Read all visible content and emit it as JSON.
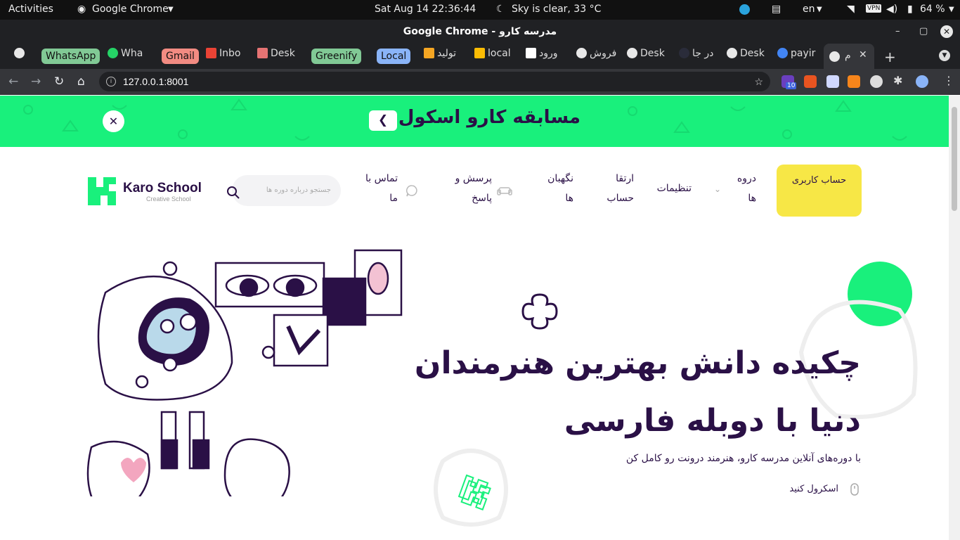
{
  "os_bar": {
    "activities": "Activities",
    "app_name": "Google Chrome",
    "datetime": "Sat Aug 14  22:36:44",
    "weather": "Sky is clear, 33 °C",
    "lang": "en",
    "vpn": "VPN",
    "battery": "64 %"
  },
  "window": {
    "title": "مدرسه کارو - Google Chrome"
  },
  "tabs": {
    "groups": [
      "WhatsApp",
      "Gmail",
      "Greenify",
      "Local"
    ],
    "items": [
      "Wha",
      "Inbo",
      "Desk",
      "تولید",
      "local",
      "ورود",
      "فروش",
      "Desk",
      "در جا",
      "Desk",
      "payir",
      "م"
    ]
  },
  "toolbar": {
    "url": "127.0.0.1:8001",
    "ext_badge": "10"
  },
  "banner": {
    "title": "مسابقه کارو اسکول"
  },
  "header": {
    "account_button": "حساب کاربری",
    "menu": [
      "دروه ها",
      "تنظیمات",
      "ارتقا حساب",
      "نگهبان ها",
      "پرسش و پاسخ",
      "تماس با ما"
    ],
    "search_placeholder": "جستجو درباره دوره ها",
    "logo_name": "Karo School",
    "logo_tagline": "Creative School"
  },
  "hero": {
    "headline_line1": "چکیده دانش بهترین هنرمندان",
    "headline_line2": "دنیا با دوبله فارسی",
    "subtitle": "با دوره‌های آنلاین مدرسه کارو، هنرمند درونت رو کامل کن",
    "scroll_hint": "اسکرول کنید"
  },
  "colors": {
    "brand_green": "#19f07c",
    "brand_purple": "#2a1046",
    "accent_yellow": "#f7e746"
  }
}
